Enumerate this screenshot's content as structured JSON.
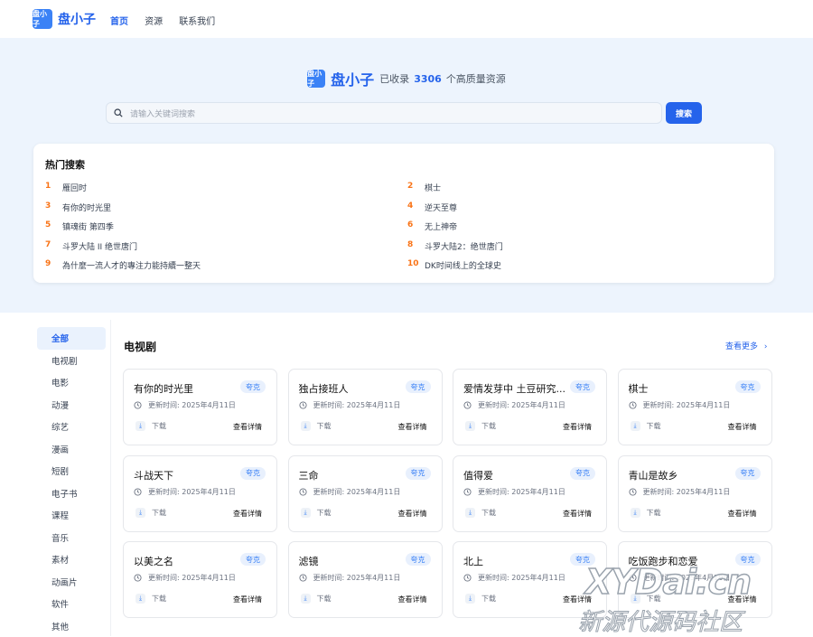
{
  "header": {
    "logo_text": "盘小子",
    "brand": "盘小子",
    "nav": [
      "首页",
      "资源",
      "联系我们"
    ]
  },
  "hero": {
    "logo_text": "盘小子",
    "brand": "盘小子",
    "prefix": "已收录",
    "count": "3306",
    "suffix": "个高质量资源",
    "search_placeholder": "请输入关键词搜索",
    "search_button": "搜索"
  },
  "hot": {
    "title": "热门搜索",
    "items": [
      {
        "rank": "1",
        "text": "雁回时"
      },
      {
        "rank": "2",
        "text": "棋士"
      },
      {
        "rank": "3",
        "text": "有你的时光里"
      },
      {
        "rank": "4",
        "text": "逆天至尊"
      },
      {
        "rank": "5",
        "text": "镇魂街 第四季"
      },
      {
        "rank": "6",
        "text": "无上神帝"
      },
      {
        "rank": "7",
        "text": "斗罗大陆 II 绝世唐门"
      },
      {
        "rank": "8",
        "text": "斗罗大陆2：绝世唐门"
      },
      {
        "rank": "9",
        "text": "為什麼一流人才的專注力能持續一整天"
      },
      {
        "rank": "10",
        "text": "DK时间线上的全球史"
      }
    ]
  },
  "sidebar": [
    "全部",
    "电视剧",
    "电影",
    "动漫",
    "综艺",
    "漫画",
    "短剧",
    "电子书",
    "课程",
    "音乐",
    "素材",
    "动画片",
    "软件",
    "其他"
  ],
  "section": {
    "title": "电视剧",
    "more": "查看更多",
    "cards": [
      {
        "title": "有你的时光里",
        "tag": "夸克",
        "time": "更新时间: 2025年4月11日",
        "download": "下载",
        "detail": "查看详情"
      },
      {
        "title": "独占接班人",
        "tag": "夸克",
        "time": "更新时间: 2025年4月11日",
        "download": "下载",
        "detail": "查看详情"
      },
      {
        "title": "爱情发芽中 土豆研究...",
        "tag": "夸克",
        "time": "更新时间: 2025年4月11日",
        "download": "下载",
        "detail": "查看详情"
      },
      {
        "title": "棋士",
        "tag": "夸克",
        "time": "更新时间: 2025年4月11日",
        "download": "下载",
        "detail": "查看详情"
      },
      {
        "title": "斗战天下",
        "tag": "夸克",
        "time": "更新时间: 2025年4月11日",
        "download": "下载",
        "detail": "查看详情"
      },
      {
        "title": "三命",
        "tag": "夸克",
        "time": "更新时间: 2025年4月11日",
        "download": "下载",
        "detail": "查看详情"
      },
      {
        "title": "值得爱",
        "tag": "夸克",
        "time": "更新时间: 2025年4月11日",
        "download": "下载",
        "detail": "查看详情"
      },
      {
        "title": "青山是故乡",
        "tag": "夸克",
        "time": "更新时间: 2025年4月11日",
        "download": "下载",
        "detail": "查看详情"
      },
      {
        "title": "以美之名",
        "tag": "夸克",
        "time": "更新时间: 2025年4月11日",
        "download": "下载",
        "detail": "查看详情"
      },
      {
        "title": "滤镜",
        "tag": "夸克",
        "time": "更新时间: 2025年4月11日",
        "download": "下载",
        "detail": "查看详情"
      },
      {
        "title": "北上",
        "tag": "夸克",
        "time": "更新时间: 2025年4月11日",
        "download": "下载",
        "detail": "查看详情"
      },
      {
        "title": "吃饭跑步和恋爱",
        "tag": "夸克",
        "time": "更新时间: 2025年4月10日",
        "download": "下载",
        "detail": "查看详情"
      }
    ]
  },
  "watermark": {
    "line1": "XYDai.cn",
    "line2": "新源代源码社区"
  },
  "colors": {
    "accent": "#2563eb",
    "hero_bg": "#edf4fd",
    "rank": "#f97316"
  }
}
